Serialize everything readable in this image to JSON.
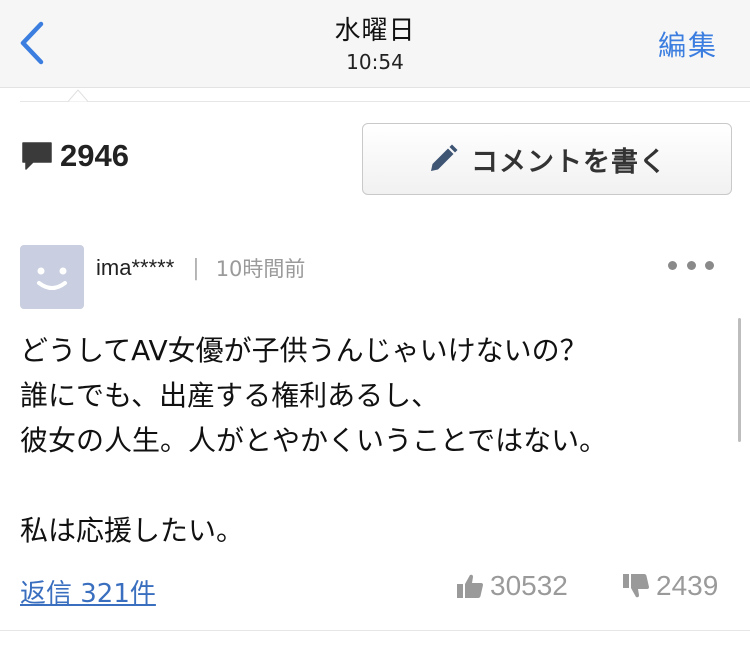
{
  "navbar": {
    "title": "水曜日",
    "subtitle": "10:54",
    "edit_label": "編集",
    "back_icon": "chevron-left-icon",
    "accent_color": "#3b7ee0"
  },
  "comments_header": {
    "count": "2946",
    "count_icon": "speech-bubble-icon",
    "write_button_label": "コメントを書く",
    "write_button_icon": "pencil-icon"
  },
  "comment": {
    "avatar_icon": "smiley-avatar-icon",
    "username": "ima*****",
    "separator": "|",
    "timestamp": "10時間前",
    "more_icon": "more-dots-icon",
    "body_lines": [
      "どうしてAV女優が子供うんじゃいけないの？",
      "誰にでも、出産する権利あるし、",
      "彼女の人生。人がとやかくいうことではない。",
      "",
      "私は応援したい。"
    ],
    "reply_label": "返信 321件",
    "like_count": "30532",
    "like_icon": "thumbs-up-icon",
    "dislike_count": "2439",
    "dislike_icon": "thumbs-down-icon"
  }
}
